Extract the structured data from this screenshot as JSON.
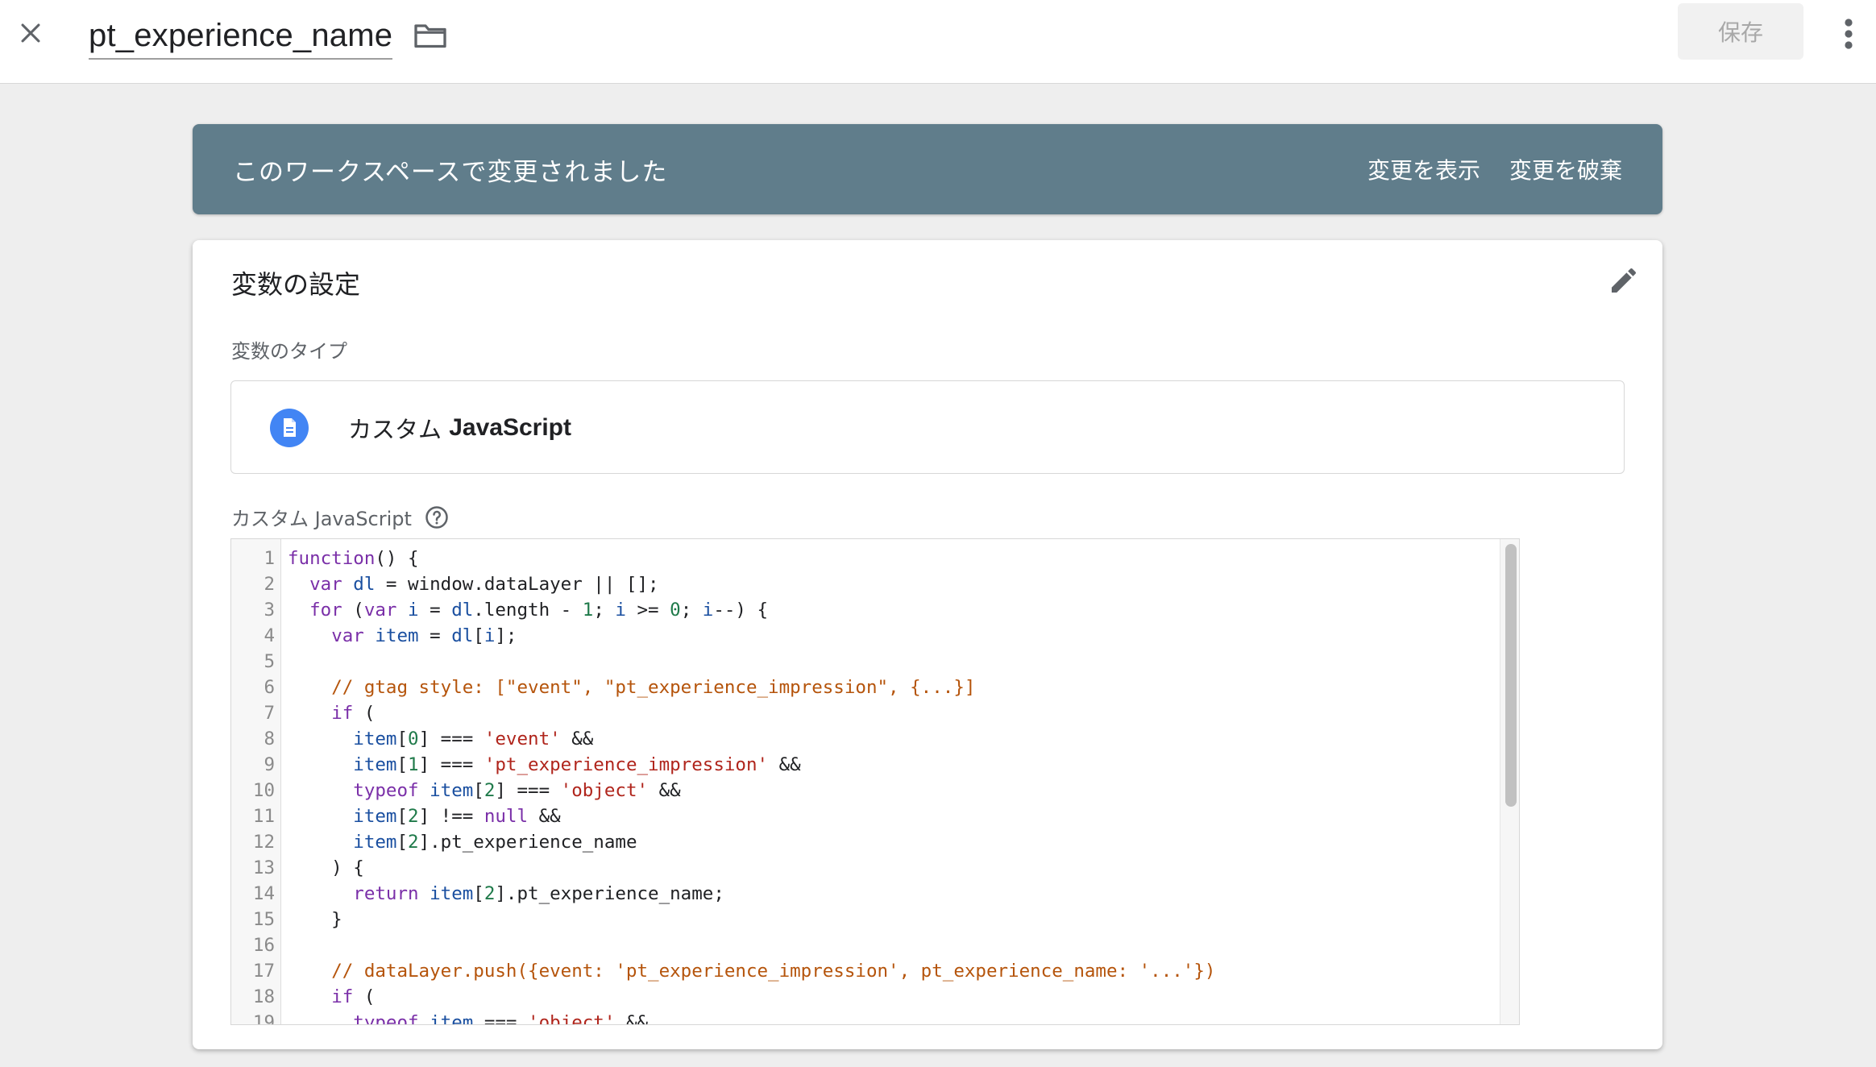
{
  "header": {
    "title": "pt_experience_name",
    "save_label": "保存",
    "close_icon": "close-icon",
    "folder_icon": "folder-icon",
    "more_icon": "more-vert-icon"
  },
  "banner": {
    "message": "このワークスペースで変更されました",
    "show_changes": "変更を表示",
    "discard_changes": "変更を破棄",
    "background": "#607d8b"
  },
  "card": {
    "title": "変数の設定",
    "edit_icon": "pencil-icon",
    "type_label": "変数のタイプ",
    "type_prefix": "カスタム",
    "type_name": "JavaScript",
    "type_icon": "document-icon",
    "type_icon_color": "#4285f4",
    "js_label": "カスタム JavaScript",
    "help_icon": "help-circle-icon"
  },
  "editor": {
    "scroll_position": 0,
    "lines": [
      "function() {",
      "  var dl = window.dataLayer || [];",
      "  for (var i = dl.length - 1; i >= 0; i--) {",
      "    var item = dl[i];",
      "",
      "    // gtag style: [\"event\", \"pt_experience_impression\", {...}]",
      "    if (",
      "      item[0] === 'event' &&",
      "      item[1] === 'pt_experience_impression' &&",
      "      typeof item[2] === 'object' &&",
      "      item[2] !== null &&",
      "      item[2].pt_experience_name",
      "    ) {",
      "      return item[2].pt_experience_name;",
      "    }",
      "",
      "    // dataLayer.push({event: 'pt_experience_impression', pt_experience_name: '...'})",
      "    if (",
      "      typeof item === 'object' &&"
    ]
  }
}
